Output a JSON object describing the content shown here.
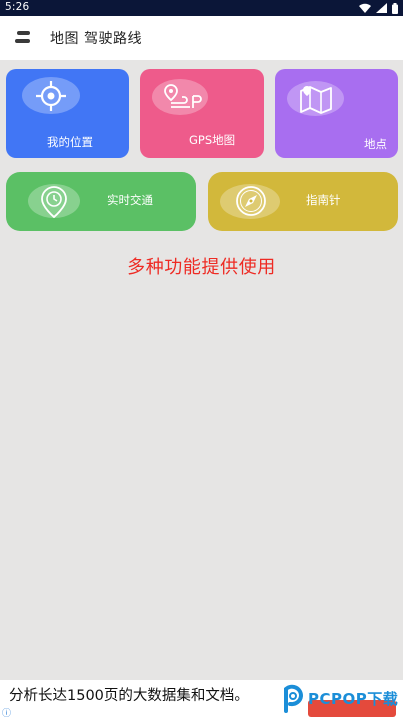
{
  "status_bar": {
    "time": "5:26",
    "icons": [
      "wifi-icon",
      "signal-icon",
      "battery-icon"
    ]
  },
  "app_bar": {
    "title": "地图 驾驶路线",
    "menu_icon": "menu-icon"
  },
  "features": [
    {
      "label": "我的位置",
      "icon": "crosshair-icon",
      "color": "#4176f5"
    },
    {
      "label": "GPS地图",
      "icon": "route-pin-icon",
      "color": "#ee5b8b"
    },
    {
      "label": "地点",
      "icon": "folded-map-icon",
      "color": "#a86ef0"
    },
    {
      "label": "实时交通",
      "icon": "clock-pin-icon",
      "color": "#5bc065"
    },
    {
      "label": "指南针",
      "icon": "compass-icon",
      "color": "#d2b83b"
    }
  ],
  "tagline": "多种功能提供使用",
  "ad": {
    "text": "分析长达1500页的大数据集和文档。",
    "watermark": "PCPOP",
    "watermark_suffix": "下载"
  },
  "colors": {
    "status_bar": "#0b1638",
    "background": "#e6e5e4",
    "tagline": "#ee2b24"
  }
}
